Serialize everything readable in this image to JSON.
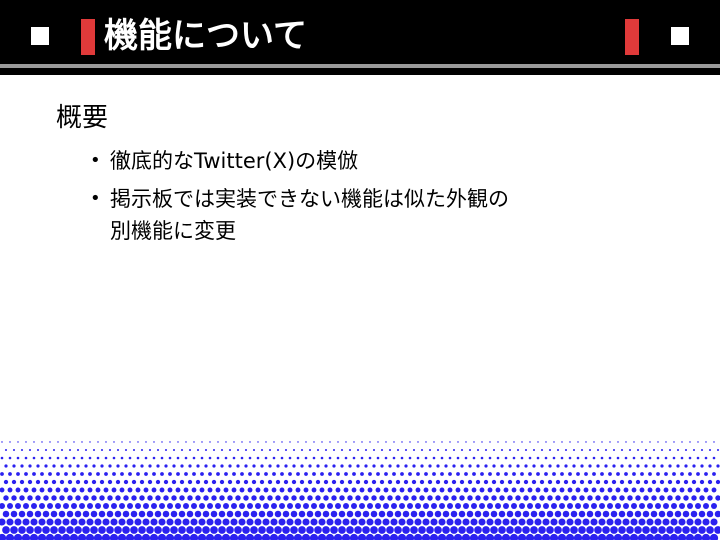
{
  "slide": {
    "title": "機能について",
    "heading": "概要",
    "bullets": [
      {
        "text": "徹底的なTwitter(X)の模倣"
      },
      {
        "text": "掲示板では実装できない機能は似た外観の\n別機能に変更"
      }
    ],
    "bullet_char": "•"
  },
  "colors": {
    "header": "#000000",
    "accent_red": "#e03a3a",
    "header_rule": "#9a9a9a",
    "dots": "#2b21f0"
  }
}
